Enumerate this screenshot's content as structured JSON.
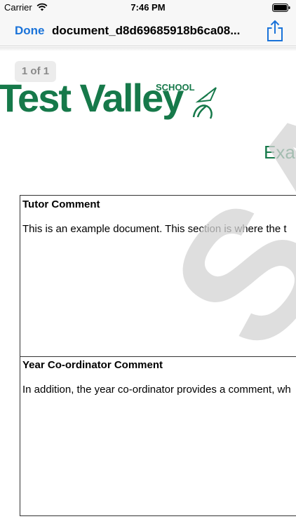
{
  "status_bar": {
    "carrier": "Carrier",
    "time": "7:46 PM",
    "wifi_icon": "wifi-icon",
    "battery_icon": "battery-icon"
  },
  "nav": {
    "done_label": "Done",
    "title": "document_d8d69685918b6ca08...",
    "share_icon": "share-icon",
    "accent_color": "#1a73d9"
  },
  "document": {
    "page_indicator": "1 of 1",
    "logo": {
      "name": "Test Valley",
      "suffix": "SCHOOL",
      "mark_icon": "dove-logo-icon",
      "brand_color": "#16794a"
    },
    "heading_partial": "Exa",
    "sections": [
      {
        "title": "Tutor Comment",
        "body": "This is an example document. This section is where the t"
      },
      {
        "title": "Year Co-ordinator Comment",
        "body": "In addition, the year co-ordinator provides a comment, wh"
      }
    ],
    "watermark": "SAM"
  }
}
